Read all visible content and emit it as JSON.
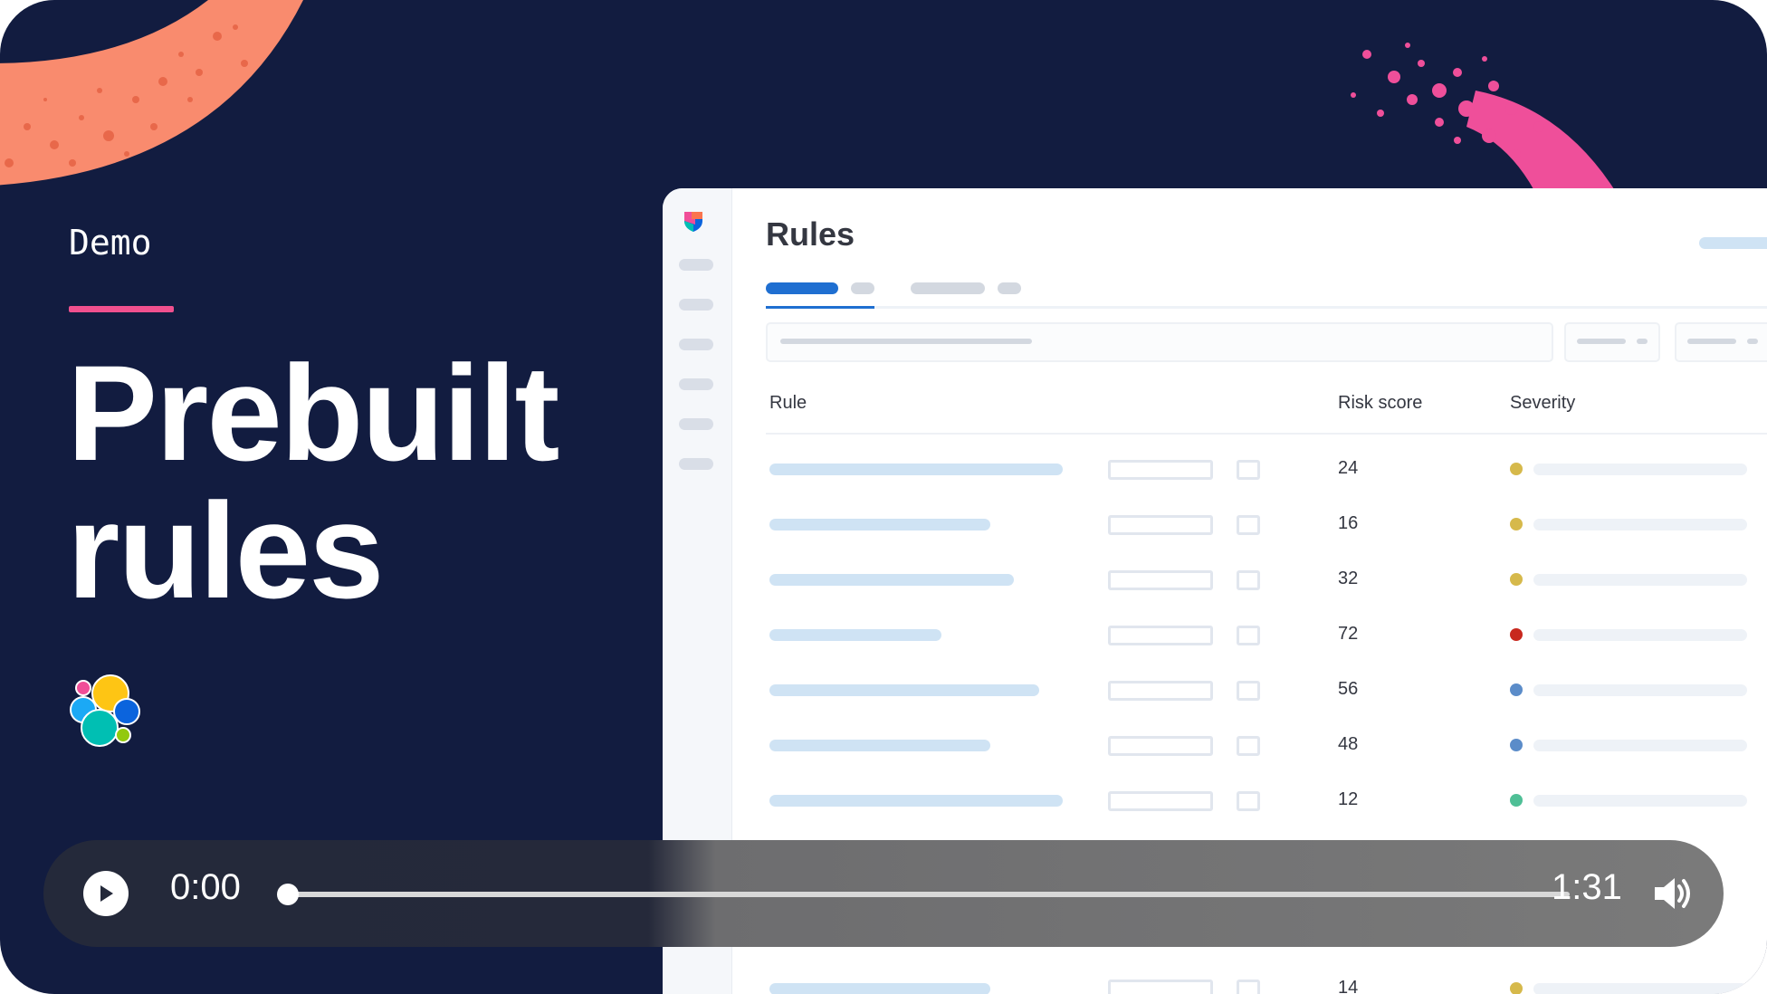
{
  "hero": {
    "eyebrow": "Demo",
    "title_line1": "Prebuilt",
    "title_line2": "rules",
    "accent_color": "#f0508e",
    "background_color": "#121c40"
  },
  "app": {
    "title": "Rules",
    "table": {
      "headers": {
        "rule": "Rule",
        "risk_score": "Risk score",
        "severity": "Severity"
      },
      "rows": [
        {
          "risk_score": "24",
          "severity_color": "#d6b94b"
        },
        {
          "risk_score": "16",
          "severity_color": "#d6b94b"
        },
        {
          "risk_score": "32",
          "severity_color": "#d6b94b"
        },
        {
          "risk_score": "72",
          "severity_color": "#c8281e"
        },
        {
          "risk_score": "56",
          "severity_color": "#5b8cc9"
        },
        {
          "risk_score": "48",
          "severity_color": "#5b8cc9"
        },
        {
          "risk_score": "12",
          "severity_color": "#4fbf96"
        },
        {
          "risk_score": "14",
          "severity_color": "#d6b94b"
        }
      ]
    }
  },
  "player": {
    "current_time": "0:00",
    "duration": "1:31",
    "progress": 0,
    "play_icon": "play-icon",
    "volume_icon": "volume-icon"
  }
}
